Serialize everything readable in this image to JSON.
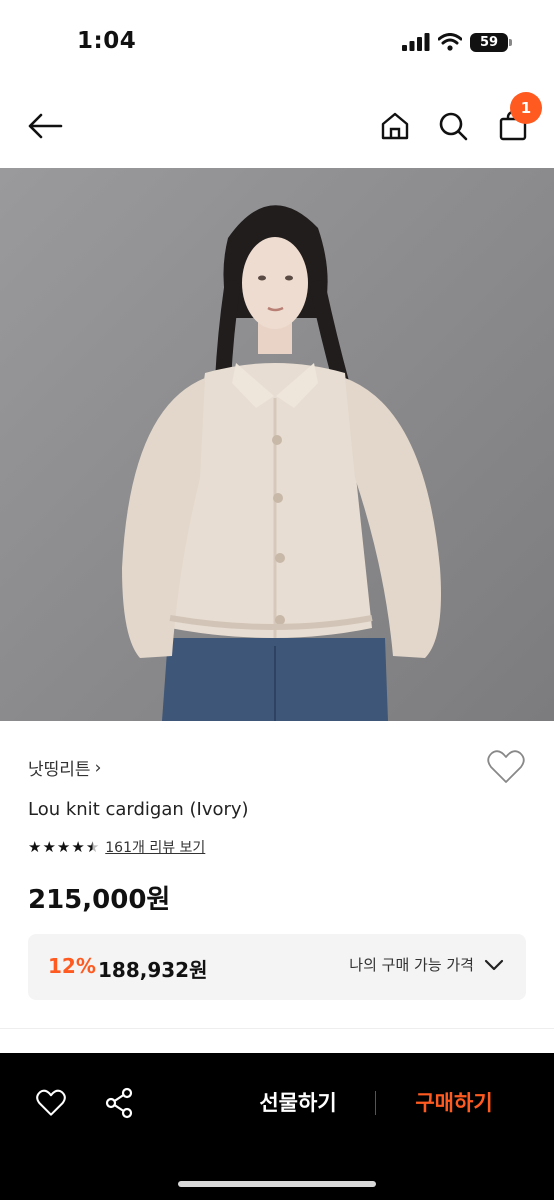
{
  "status_bar": {
    "time": "1:04",
    "battery": "59"
  },
  "nav": {
    "cart_count": "1",
    "icons": [
      "arrow-left-icon",
      "home-icon",
      "search-icon",
      "shopping-bag-icon"
    ]
  },
  "product": {
    "brand": "낫띵리튼",
    "brand_chevron": "›",
    "name": "Lou knit cardigan (Ivory)",
    "rating": 4.5,
    "review_link": "161개 리뷰 보기",
    "price": "215,000원",
    "discount_rate": "12%",
    "discount_price": "188,932원",
    "my_price_label": "나의 구매 가능 가격"
  },
  "bottom_bar": {
    "gift_label": "선물하기",
    "buy_label": "구매하기"
  },
  "colors": {
    "accent": "#ff5a1f",
    "bottom_bar_bg": "#000000",
    "price_box_bg": "#f4f4f5"
  }
}
